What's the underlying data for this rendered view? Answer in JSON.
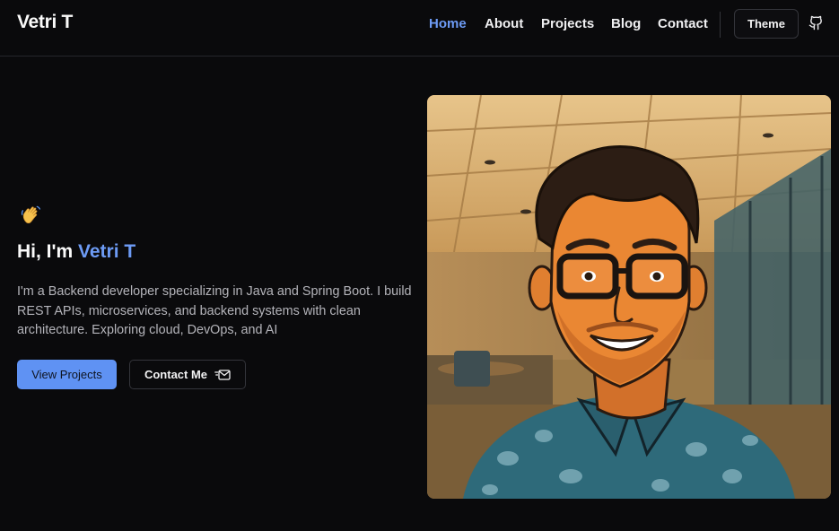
{
  "header": {
    "brand": "Vetri T",
    "nav": [
      {
        "label": "Home",
        "active": true
      },
      {
        "label": "About",
        "active": false
      },
      {
        "label": "Projects",
        "active": false
      },
      {
        "label": "Blog",
        "active": false
      },
      {
        "label": "Contact",
        "active": false
      }
    ],
    "theme_label": "Theme",
    "github_icon": "github-icon"
  },
  "hero": {
    "wave_emoji": "👋",
    "greeting": "Hi, I'm ",
    "name": "Vetri T",
    "description": "I'm a Backend developer specializing in Java and Spring Boot. I build REST APIs, microservices, and backend systems with clean architecture. Exploring cloud, DevOps, and AI",
    "primary_button": "View Projects",
    "secondary_button": "Contact Me",
    "secondary_icon": "mail-send-icon",
    "portrait_icon": "cartoon-portrait-illustration"
  },
  "colors": {
    "background": "#0a0a0c",
    "accent": "#6d9bf5",
    "primary_button": "#5f92f3",
    "text": "#f2f2f3",
    "muted_text": "#b4b4ba",
    "border": "#34353b"
  }
}
